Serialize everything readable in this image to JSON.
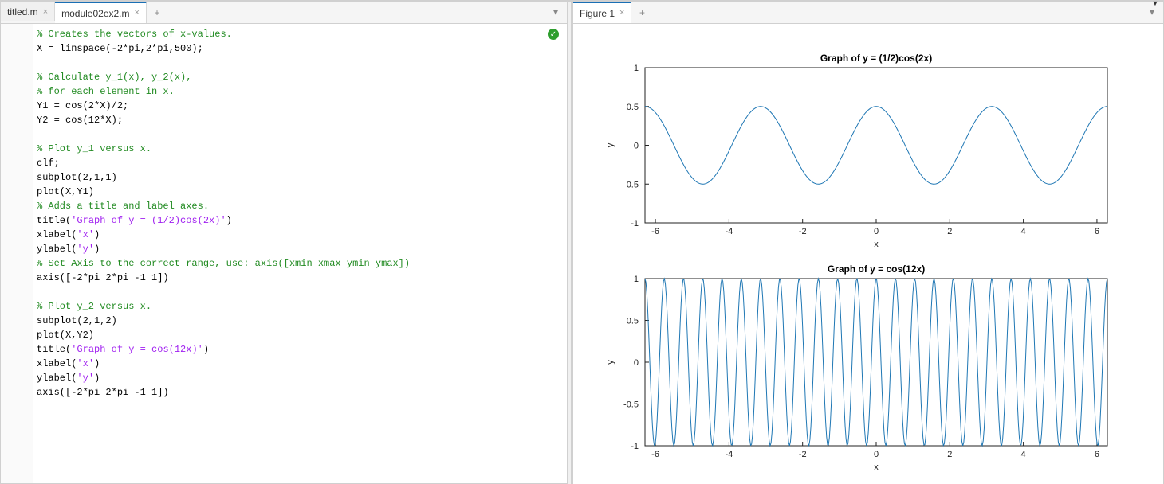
{
  "editor": {
    "tabs": [
      {
        "label": "titled.m",
        "active": false
      },
      {
        "label": "module02ex2.m",
        "active": true
      }
    ],
    "add_tab_glyph": "+",
    "menu_glyph": "▾",
    "status_ok_glyph": "✓",
    "code_lines": [
      {
        "t": "comment",
        "text": "% Creates the vectors of x-values."
      },
      {
        "t": "plain",
        "text": "X = linspace(-2*pi,2*pi,500);"
      },
      {
        "t": "blank",
        "text": ""
      },
      {
        "t": "comment",
        "text": "% Calculate y_1(x), y_2(x),"
      },
      {
        "t": "comment",
        "text": "% for each element in x."
      },
      {
        "t": "plain",
        "text": "Y1 = cos(2*X)/2;"
      },
      {
        "t": "plain",
        "text": "Y2 = cos(12*X);"
      },
      {
        "t": "blank",
        "text": ""
      },
      {
        "t": "comment",
        "text": "% Plot y_1 versus x."
      },
      {
        "t": "plain",
        "text": "clf;"
      },
      {
        "t": "plain",
        "text": "subplot(2,1,1)"
      },
      {
        "t": "plain",
        "text": "plot(X,Y1)"
      },
      {
        "t": "comment",
        "text": "% Adds a title and label axes."
      },
      {
        "t": "mixed",
        "pre": "title(",
        "str": "'Graph of y = (1/2)cos(2x)'",
        "post": ")"
      },
      {
        "t": "mixed",
        "pre": "xlabel(",
        "str": "'x'",
        "post": ")"
      },
      {
        "t": "mixed",
        "pre": "ylabel(",
        "str": "'y'",
        "post": ")"
      },
      {
        "t": "comment",
        "text": "% Set Axis to the correct range, use: axis([xmin xmax ymin ymax])"
      },
      {
        "t": "plain",
        "text": "axis([-2*pi 2*pi -1 1])"
      },
      {
        "t": "blank",
        "text": ""
      },
      {
        "t": "comment",
        "text": "% Plot y_2 versus x."
      },
      {
        "t": "plain",
        "text": "subplot(2,1,2)"
      },
      {
        "t": "plain",
        "text": "plot(X,Y2)"
      },
      {
        "t": "mixed",
        "pre": "title(",
        "str": "'Graph of y = cos(12x)'",
        "post": ")"
      },
      {
        "t": "mixed",
        "pre": "xlabel(",
        "str": "'x'",
        "post": ")"
      },
      {
        "t": "mixed",
        "pre": "ylabel(",
        "str": "'y'",
        "post": ")"
      },
      {
        "t": "plain",
        "text": "axis([-2*pi 2*pi -1 1])"
      }
    ]
  },
  "figure": {
    "tab_label": "Figure 1",
    "add_tab_glyph": "+",
    "menu_glyph": "▾"
  },
  "chart_data": [
    {
      "type": "line",
      "title": "Graph of y = (1/2)cos(2x)",
      "xlabel": "x",
      "ylabel": "y",
      "xlim": [
        -6.2832,
        6.2832
      ],
      "ylim": [
        -1,
        1
      ],
      "xticks": [
        -6,
        -4,
        -2,
        0,
        2,
        4,
        6
      ],
      "yticks": [
        -1,
        -0.5,
        0,
        0.5,
        1
      ],
      "function": "0.5*cos(2*x)",
      "n_points": 500
    },
    {
      "type": "line",
      "title": "Graph of y = cos(12x)",
      "xlabel": "x",
      "ylabel": "y",
      "xlim": [
        -6.2832,
        6.2832
      ],
      "ylim": [
        -1,
        1
      ],
      "xticks": [
        -6,
        -4,
        -2,
        0,
        2,
        4,
        6
      ],
      "yticks": [
        -1,
        -0.5,
        0,
        0.5,
        1
      ],
      "function": "cos(12*x)",
      "n_points": 500
    }
  ]
}
